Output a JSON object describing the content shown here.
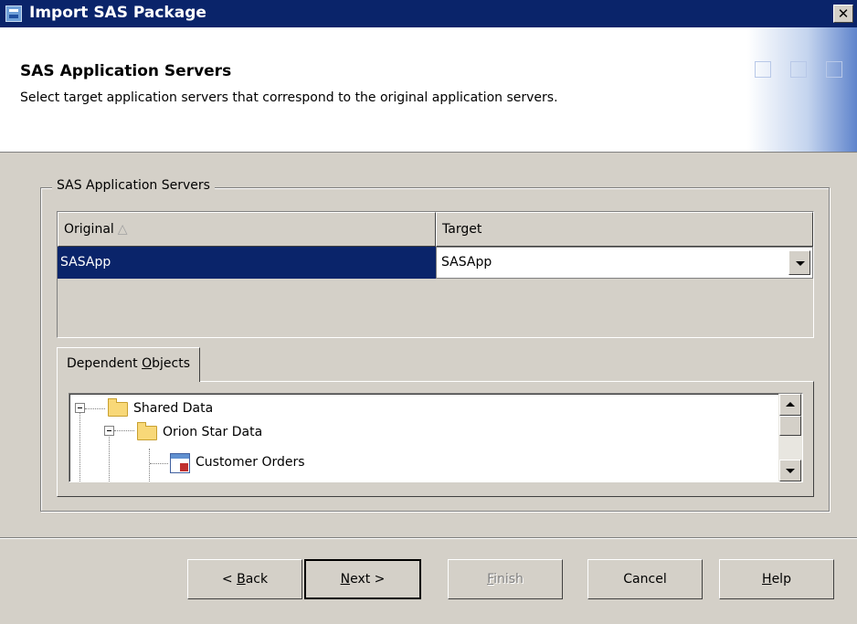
{
  "window": {
    "title": "Import SAS Package",
    "close_label": "✕"
  },
  "header": {
    "heading": "SAS Application Servers",
    "description": "Select target application servers that correspond to the original application servers."
  },
  "group": {
    "legend": "SAS Application Servers",
    "columns": [
      {
        "label": "Original",
        "sort_indicator": "△"
      },
      {
        "label": "Target"
      }
    ],
    "rows": [
      {
        "original": "SASApp",
        "target": "SASApp"
      }
    ]
  },
  "dependent_tab": {
    "label_pre": "Dependent ",
    "label_mnemonic": "O",
    "label_post": "bjects"
  },
  "tree": [
    {
      "label": "Shared Data",
      "icon": "folder-icon",
      "expanded": true
    },
    {
      "label": "Orion Star Data",
      "icon": "folder-icon",
      "expanded": true
    },
    {
      "label": "Customer Orders",
      "icon": "table-icon"
    }
  ],
  "buttons": {
    "back": {
      "pre": "< ",
      "mnemonic": "B",
      "post": "ack"
    },
    "next": {
      "pre": "",
      "mnemonic": "N",
      "post": "ext >"
    },
    "finish": {
      "pre": "",
      "mnemonic": "F",
      "post": "inish"
    },
    "cancel": {
      "label": "Cancel"
    },
    "help": {
      "pre": "",
      "mnemonic": "H",
      "post": "elp"
    }
  },
  "colors": {
    "titlebar": "#0a246a",
    "selection": "#0a246a",
    "face": "#d4d0c8"
  }
}
